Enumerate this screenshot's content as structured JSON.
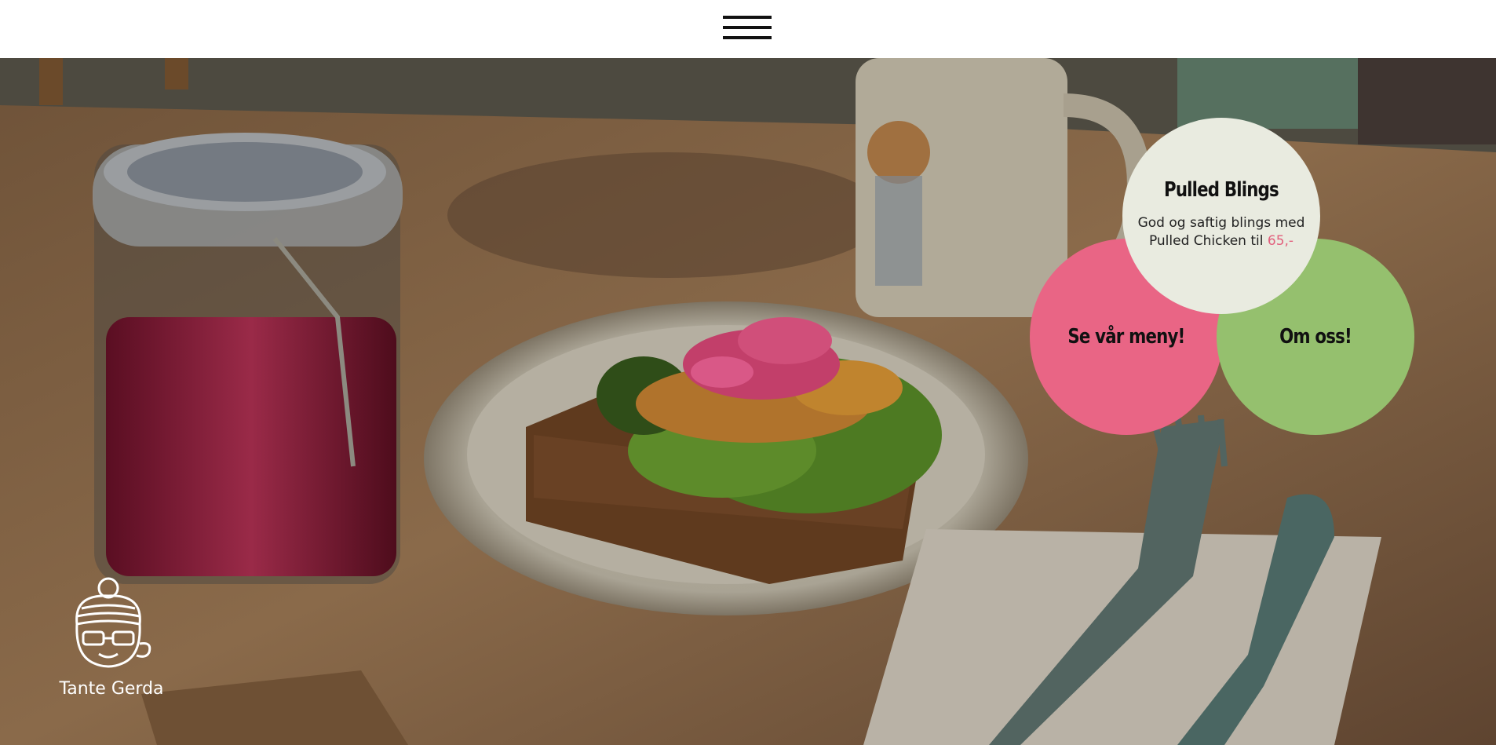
{
  "nav": {
    "menu_icon": "hamburger-menu-icon"
  },
  "hero": {
    "image": "open-faced pulled chicken sandwich on plate with pickled red onion jar, coffee mug and cutlery on wooden table"
  },
  "special": {
    "title": "Pulled Blings",
    "description": "God og saftig blings med Pulled Chicken til ",
    "price": "65,-"
  },
  "buttons": {
    "menu_label": "Se vår meny!",
    "about_label": "Om oss!"
  },
  "logo": {
    "text": "Tante Gerda"
  },
  "colors": {
    "menu_circle": "#e96585",
    "about_circle": "#95c06e",
    "special_circle": "#e9ebe0",
    "price": "#e2607d"
  }
}
